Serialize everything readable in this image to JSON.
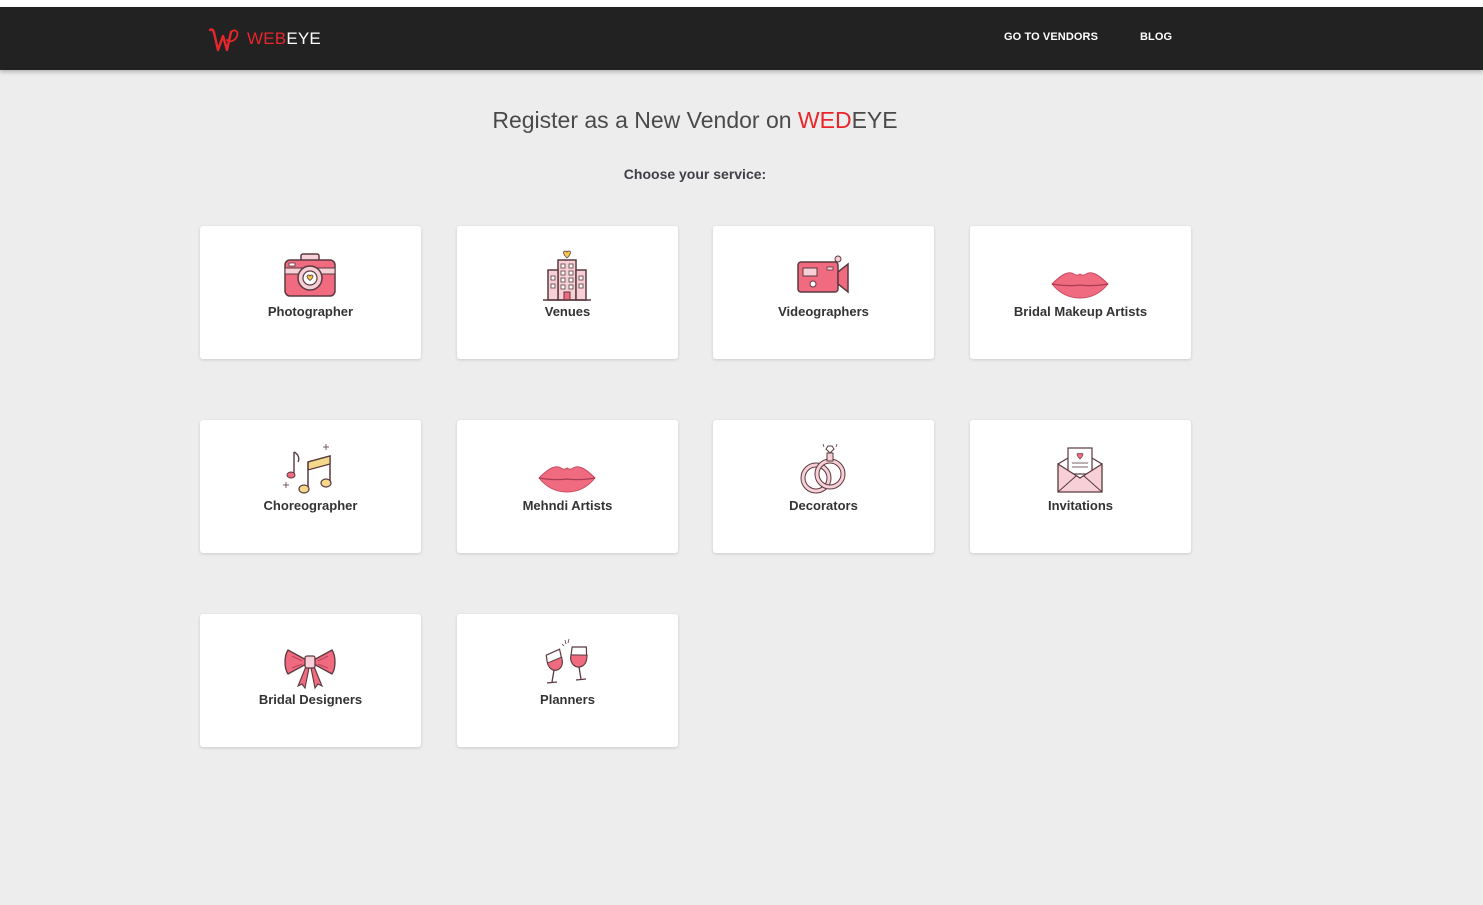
{
  "navbar": {
    "brand": {
      "part1": "WEB",
      "part2": "EYE",
      "logo_icon": "w-script-logo-icon"
    },
    "links": [
      {
        "label": "GO TO VENDORS"
      },
      {
        "label": "BLOG"
      }
    ]
  },
  "main": {
    "title_prefix": "Register as a New Vendor on ",
    "title_brand_red": "WED",
    "title_brand_rest": "EYE",
    "subtitle": "Choose your service:"
  },
  "services": [
    {
      "label": "Photographer",
      "icon": "camera-icon"
    },
    {
      "label": "Venues",
      "icon": "building-icon"
    },
    {
      "label": "Videographers",
      "icon": "video-camera-icon"
    },
    {
      "label": "Bridal Makeup Artists",
      "icon": "lips-icon"
    },
    {
      "label": "Choreographer",
      "icon": "music-notes-icon"
    },
    {
      "label": "Mehndi Artists",
      "icon": "lips-icon"
    },
    {
      "label": "Decorators",
      "icon": "rings-icon"
    },
    {
      "label": "Invitations",
      "icon": "envelope-icon"
    },
    {
      "label": "Bridal Designers",
      "icon": "bow-icon"
    },
    {
      "label": "Planners",
      "icon": "wine-glasses-icon"
    }
  ],
  "colors": {
    "navbar_bg": "#222222",
    "accent_red": "#e8262b",
    "page_bg": "#ededed",
    "icon_pink": "#f06a80",
    "icon_light_pink": "#f7cfd6"
  }
}
